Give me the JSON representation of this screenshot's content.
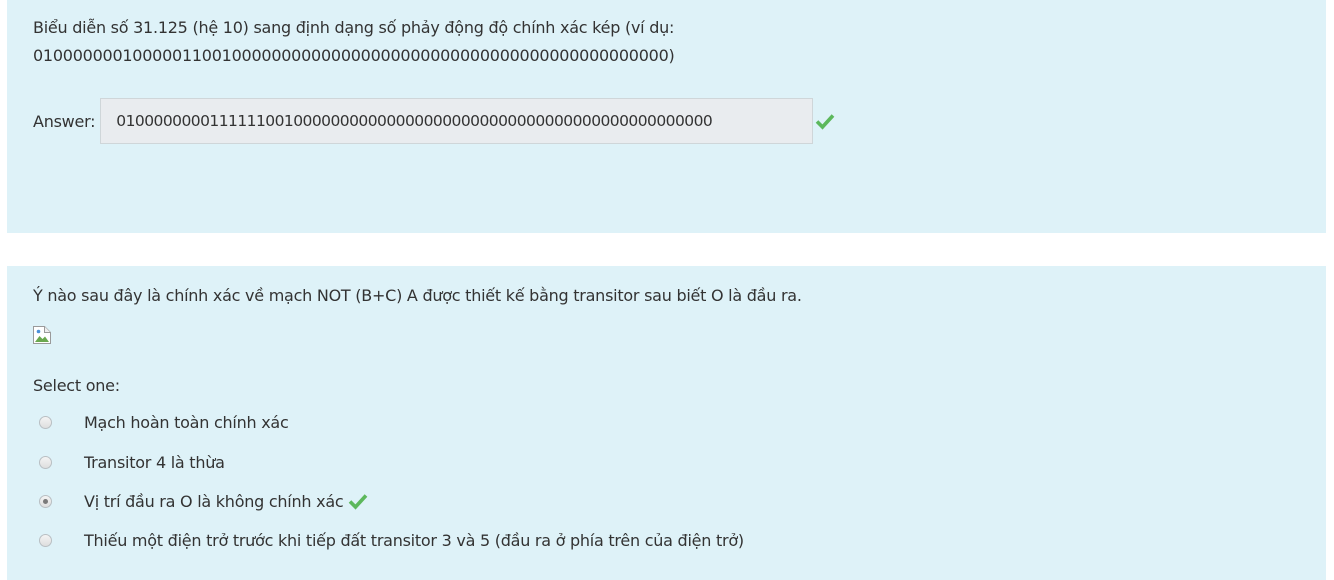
{
  "question1": {
    "text_line1": "Biểu diễn số 31.125 (hệ 10) sang định dạng số phảy động độ chính xác kép (ví dụ:",
    "text_line2": "0100000001000001100100000000000000000000000000000000000000000000)",
    "answer_label": "Answer:",
    "answer_value": "0100000000111111001000000000000000000000000000000000000000000000",
    "status_icon": "check-icon",
    "status_color": "#5cb85c"
  },
  "question2": {
    "text": "Ý nào sau đây là chính xác về mạch NOT (B+C) A được thiết kế bằng transitor sau biết O là đầu ra.",
    "image_icon": "broken-image-icon",
    "select_label": "Select one:",
    "options": [
      {
        "label": "Mạch hoàn toàn chính xác",
        "selected": false
      },
      {
        "label": "Transitor 4 là thừa",
        "selected": false
      },
      {
        "label": "Vị trí đầu ra O là không chính xác",
        "selected": true,
        "correct": true
      },
      {
        "label": "Thiếu một điện trở trước khi tiếp đất transitor 3 và 5 (đầu ra ở phía trên của điện trở)",
        "selected": false
      }
    ]
  },
  "colors": {
    "panel_background": "#def2f8",
    "text": "#333333",
    "correct": "#5cb85c"
  }
}
